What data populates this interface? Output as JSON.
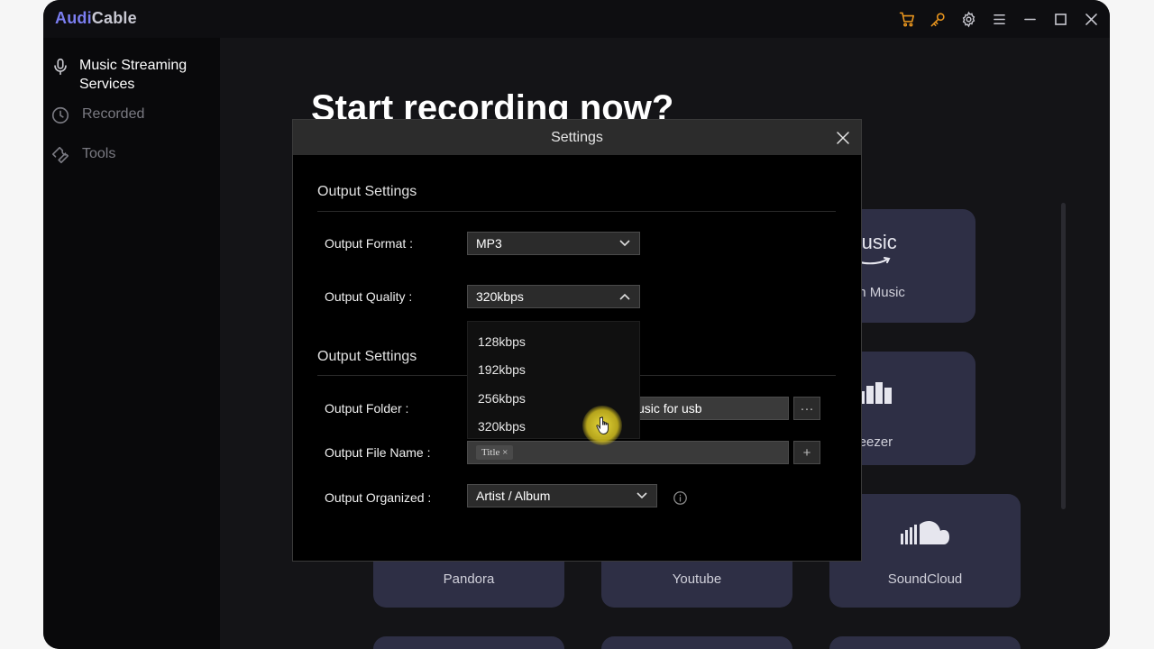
{
  "app": {
    "logo_part1": "Audi",
    "logo_part2": "Cable",
    "titlebar_icons": [
      "cart-icon",
      "key-icon",
      "gear-icon",
      "menu-icon",
      "minimize-icon",
      "maximize-icon",
      "close-icon"
    ],
    "accent_color": "#e8951e"
  },
  "sidebar": {
    "items": [
      {
        "label": "Music Streaming Services",
        "icon": "microphone-icon"
      },
      {
        "label": "Recorded",
        "icon": "clock-icon"
      },
      {
        "label": "Tools",
        "icon": "wrench-icon"
      }
    ]
  },
  "main": {
    "headline": "Start recording now?",
    "tiles": [
      {
        "label": "azon Music",
        "glyph": "music"
      },
      {
        "label": "Deezer"
      },
      {
        "label": "Pandora"
      },
      {
        "label": "Youtube"
      },
      {
        "label": "SoundCloud"
      }
    ]
  },
  "settings": {
    "title": "Settings",
    "section1": "Output Settings",
    "format_label": "Output Format :",
    "format_value": "MP3",
    "quality_label": "Output Quality :",
    "quality_value": "320kbps",
    "section2": "Output Settings",
    "folder_label": "Output Folder :",
    "folder_value": "usic for usb",
    "folder_button": "···",
    "filename_label": "Output File Name :",
    "filename_tag": "Title ×",
    "filename_add": "+",
    "organized_label": "Output Organized :",
    "organized_value": "Artist / Album",
    "quality_options": [
      "128kbps",
      "192kbps",
      "256kbps",
      "320kbps"
    ]
  }
}
